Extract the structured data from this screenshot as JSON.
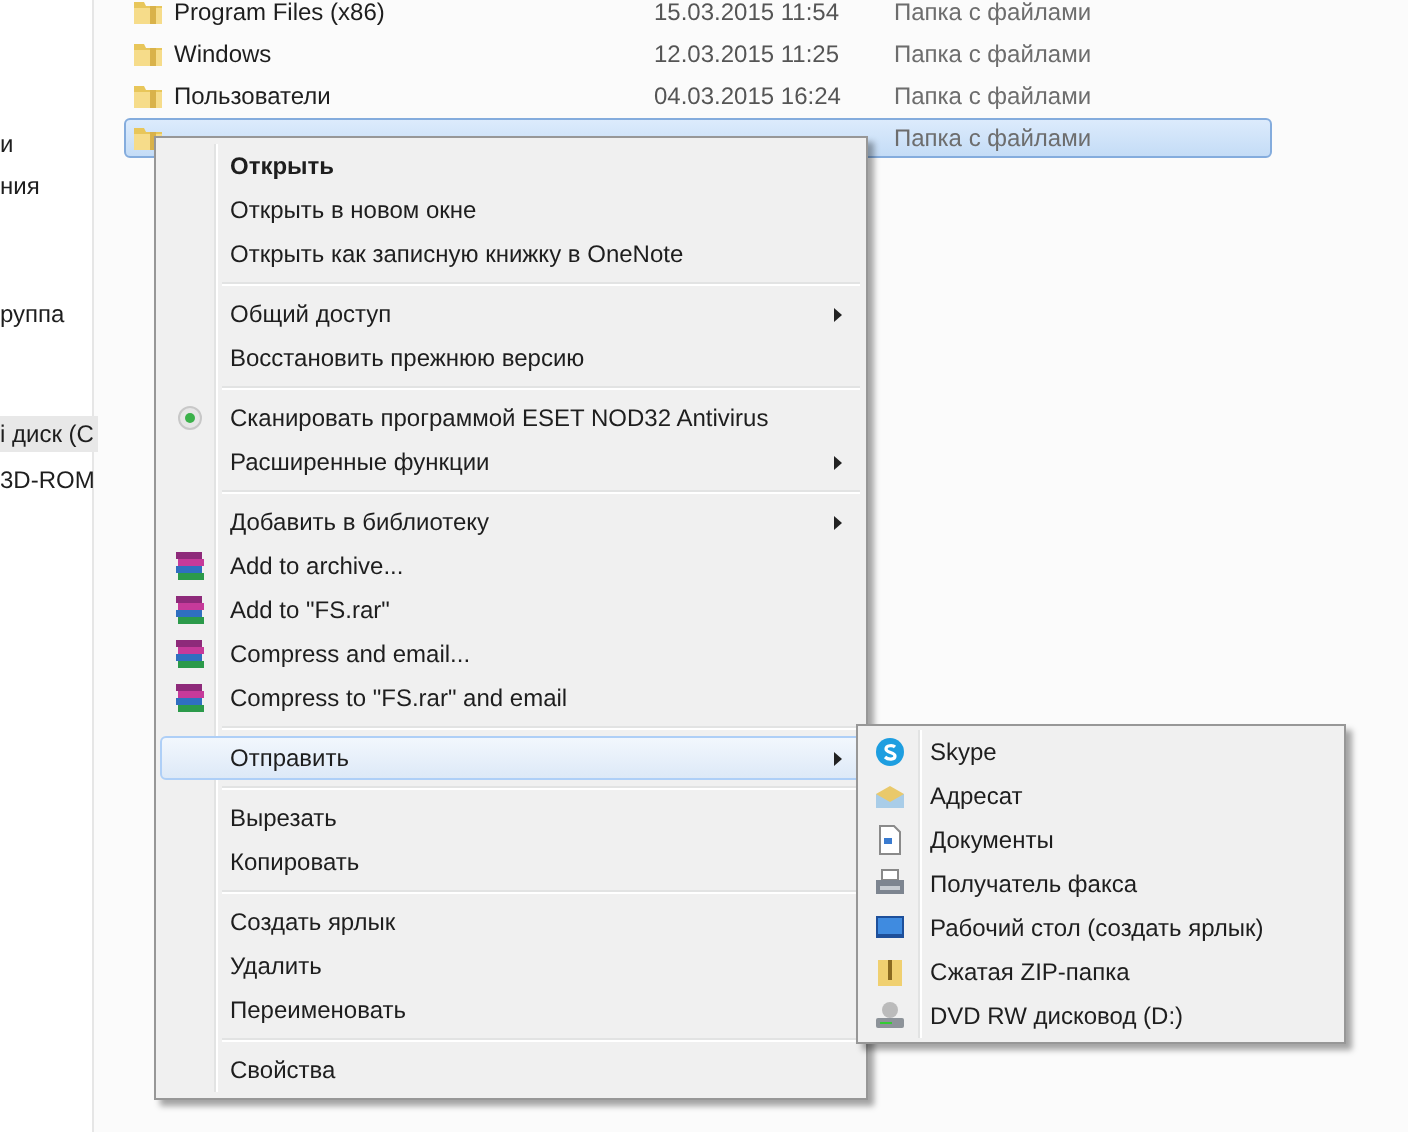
{
  "sidebar": {
    "items": [
      {
        "label": "и",
        "selected": false
      },
      {
        "label": "ния",
        "selected": false
      },
      {
        "label": "руппа",
        "selected": false
      },
      {
        "label": "і диск (С",
        "selected": true
      },
      {
        "label": "3D-ROM",
        "selected": false
      }
    ]
  },
  "files": [
    {
      "name": "Program Files (x86)",
      "date": "15.03.2015 11:54",
      "type": "Папка с файлами",
      "selected": false
    },
    {
      "name": "Windows",
      "date": "12.03.2015 11:25",
      "type": "Папка с файлами",
      "selected": false
    },
    {
      "name": "Пользователи",
      "date": "04.03.2015 16:24",
      "type": "Папка с файлами",
      "selected": false
    },
    {
      "type": "Папка с файлами",
      "selected": true
    }
  ],
  "context_menu": {
    "groups": [
      [
        {
          "label": "Открыть",
          "kind": "plain",
          "bold": true,
          "has_submenu": false,
          "selected": false
        },
        {
          "label": "Открыть в новом окне",
          "kind": "plain",
          "bold": false,
          "has_submenu": false,
          "selected": false
        },
        {
          "label": "Открыть как записную книжку в OneNote",
          "kind": "plain",
          "bold": false,
          "has_submenu": false,
          "selected": false
        }
      ],
      [
        {
          "label": "Общий доступ",
          "kind": "plain",
          "bold": false,
          "has_submenu": true,
          "selected": false
        },
        {
          "label": "Восстановить прежнюю версию",
          "kind": "plain",
          "bold": false,
          "has_submenu": false,
          "selected": false
        }
      ],
      [
        {
          "label": "Сканировать программой ESET NOD32 Antivirus",
          "kind": "scan",
          "bold": false,
          "has_submenu": false,
          "selected": false
        },
        {
          "label": "Расширенные функции",
          "kind": "plain",
          "bold": false,
          "has_submenu": true,
          "selected": false
        }
      ],
      [
        {
          "label": "Добавить в библиотеку",
          "kind": "plain",
          "bold": false,
          "has_submenu": true,
          "selected": false
        },
        {
          "label": "Add to archive...",
          "kind": "archive",
          "bold": false,
          "has_submenu": false,
          "selected": false
        },
        {
          "label": "Add to \"FS.rar\"",
          "kind": "archive",
          "bold": false,
          "has_submenu": false,
          "selected": false
        },
        {
          "label": "Compress and email...",
          "kind": "archive",
          "bold": false,
          "has_submenu": false,
          "selected": false
        },
        {
          "label": "Compress to \"FS.rar\" and email",
          "kind": "archive",
          "bold": false,
          "has_submenu": false,
          "selected": false
        }
      ],
      [
        {
          "label": "Отправить",
          "kind": "plain",
          "bold": false,
          "has_submenu": true,
          "selected": true
        }
      ],
      [
        {
          "label": "Вырезать",
          "kind": "plain",
          "bold": false,
          "has_submenu": false,
          "selected": false
        },
        {
          "label": "Копировать",
          "kind": "plain",
          "bold": false,
          "has_submenu": false,
          "selected": false
        }
      ],
      [
        {
          "label": "Создать ярлык",
          "kind": "plain",
          "bold": false,
          "has_submenu": false,
          "selected": false
        },
        {
          "label": "Удалить",
          "kind": "plain",
          "bold": false,
          "has_submenu": false,
          "selected": false
        },
        {
          "label": "Переименовать",
          "kind": "plain",
          "bold": false,
          "has_submenu": false,
          "selected": false
        }
      ],
      [
        {
          "label": "Свойства",
          "kind": "plain",
          "bold": false,
          "has_submenu": false,
          "selected": false
        }
      ]
    ]
  },
  "send_to_menu": {
    "items": [
      {
        "label": "Skype",
        "kind": "skype"
      },
      {
        "label": "Адресат",
        "kind": "mail"
      },
      {
        "label": "Документы",
        "kind": "documents"
      },
      {
        "label": "Получатель факса",
        "kind": "fax"
      },
      {
        "label": "Рабочий стол (создать ярлык)",
        "kind": "desktop"
      },
      {
        "label": "Сжатая ZIP-папка",
        "kind": "zip"
      },
      {
        "label": "DVD RW дисковод (D:)",
        "kind": "dvd"
      }
    ]
  }
}
